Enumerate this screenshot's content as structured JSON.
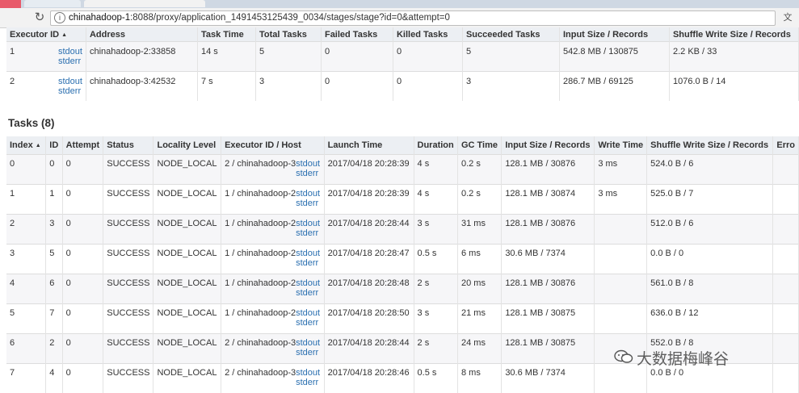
{
  "browser": {
    "url_host": "chinahadoop-1",
    "url_rest": ":8088/proxy/application_1491453125439_0034/stages/stage?id=0&attempt=0"
  },
  "executors": {
    "headers": [
      "Executor ID",
      "Address",
      "Task Time",
      "Total Tasks",
      "Failed Tasks",
      "Killed Tasks",
      "Succeeded Tasks",
      "Input Size / Records",
      "Shuffle Write Size / Records"
    ],
    "rows": [
      {
        "id": "1",
        "stdout": "stdout",
        "stderr": "stderr",
        "address": "chinahadoop-2:33858",
        "task_time": "14 s",
        "total": "5",
        "failed": "0",
        "killed": "0",
        "succeeded": "5",
        "input": "542.8 MB / 130875",
        "shuffle": "2.2 KB / 33"
      },
      {
        "id": "2",
        "stdout": "stdout",
        "stderr": "stderr",
        "address": "chinahadoop-3:42532",
        "task_time": "7 s",
        "total": "3",
        "failed": "0",
        "killed": "0",
        "succeeded": "3",
        "input": "286.7 MB / 69125",
        "shuffle": "1076.0 B / 14"
      }
    ]
  },
  "tasks": {
    "title": "Tasks (8)",
    "headers": [
      "Index",
      "ID",
      "Attempt",
      "Status",
      "Locality Level",
      "Executor ID / Host",
      "Launch Time",
      "Duration",
      "GC Time",
      "Input Size / Records",
      "Write Time",
      "Shuffle Write Size / Records",
      "Erro"
    ],
    "rows": [
      {
        "index": "0",
        "id": "0",
        "attempt": "0",
        "status": "SUCCESS",
        "locality": "NODE_LOCAL",
        "host": "2 / chinahadoop-3",
        "stdout": "stdout",
        "stderr": "stderr",
        "launch": "2017/04/18 20:28:39",
        "duration": "4 s",
        "gc": "0.2 s",
        "input": "128.1 MB / 30876",
        "write_time": "3 ms",
        "shuffle": "524.0 B / 6"
      },
      {
        "index": "1",
        "id": "1",
        "attempt": "0",
        "status": "SUCCESS",
        "locality": "NODE_LOCAL",
        "host": "1 / chinahadoop-2",
        "stdout": "stdout",
        "stderr": "stderr",
        "launch": "2017/04/18 20:28:39",
        "duration": "4 s",
        "gc": "0.2 s",
        "input": "128.1 MB / 30874",
        "write_time": "3 ms",
        "shuffle": "525.0 B / 7"
      },
      {
        "index": "2",
        "id": "3",
        "attempt": "0",
        "status": "SUCCESS",
        "locality": "NODE_LOCAL",
        "host": "1 / chinahadoop-2",
        "stdout": "stdout",
        "stderr": "stderr",
        "launch": "2017/04/18 20:28:44",
        "duration": "3 s",
        "gc": "31 ms",
        "input": "128.1 MB / 30876",
        "write_time": "",
        "shuffle": "512.0 B / 6"
      },
      {
        "index": "3",
        "id": "5",
        "attempt": "0",
        "status": "SUCCESS",
        "locality": "NODE_LOCAL",
        "host": "1 / chinahadoop-2",
        "stdout": "stdout",
        "stderr": "stderr",
        "launch": "2017/04/18 20:28:47",
        "duration": "0.5 s",
        "gc": "6 ms",
        "input": "30.6 MB / 7374",
        "write_time": "",
        "shuffle": "0.0 B / 0"
      },
      {
        "index": "4",
        "id": "6",
        "attempt": "0",
        "status": "SUCCESS",
        "locality": "NODE_LOCAL",
        "host": "1 / chinahadoop-2",
        "stdout": "stdout",
        "stderr": "stderr",
        "launch": "2017/04/18 20:28:48",
        "duration": "2 s",
        "gc": "20 ms",
        "input": "128.1 MB / 30876",
        "write_time": "",
        "shuffle": "561.0 B / 8"
      },
      {
        "index": "5",
        "id": "7",
        "attempt": "0",
        "status": "SUCCESS",
        "locality": "NODE_LOCAL",
        "host": "1 / chinahadoop-2",
        "stdout": "stdout",
        "stderr": "stderr",
        "launch": "2017/04/18 20:28:50",
        "duration": "3 s",
        "gc": "21 ms",
        "input": "128.1 MB / 30875",
        "write_time": "",
        "shuffle": "636.0 B / 12"
      },
      {
        "index": "6",
        "id": "2",
        "attempt": "0",
        "status": "SUCCESS",
        "locality": "NODE_LOCAL",
        "host": "2 / chinahadoop-3",
        "stdout": "stdout",
        "stderr": "stderr",
        "launch": "2017/04/18 20:28:44",
        "duration": "2 s",
        "gc": "24 ms",
        "input": "128.1 MB / 30875",
        "write_time": "",
        "shuffle": "552.0 B / 8"
      },
      {
        "index": "7",
        "id": "4",
        "attempt": "0",
        "status": "SUCCESS",
        "locality": "NODE_LOCAL",
        "host": "2 / chinahadoop-3",
        "stdout": "stdout",
        "stderr": "stderr",
        "launch": "2017/04/18 20:28:46",
        "duration": "0.5 s",
        "gc": "8 ms",
        "input": "30.6 MB / 7374",
        "write_time": "",
        "shuffle": "0.0 B / 0"
      }
    ]
  },
  "watermark": "大数据梅峰谷",
  "icons": {
    "reload": "reload-icon",
    "info": "info-icon",
    "translate": "translate-icon",
    "sort": "sort-icon",
    "wechat": "wechat-icon"
  }
}
